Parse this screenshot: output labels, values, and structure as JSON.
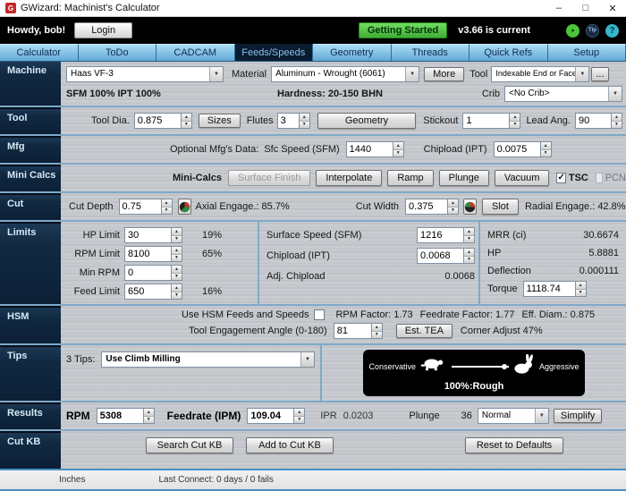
{
  "window": {
    "title": "GWizard: Machinist's Calculator",
    "logo_text": "G",
    "minimize_label": "–",
    "maximize_label": "□",
    "close_label": "✕"
  },
  "topbar": {
    "greeting": "Howdy, bob!",
    "login_label": "Login",
    "getting_started_label": "Getting Started",
    "version_text": "v3.66 is current",
    "tip_label": "Tip",
    "help_label": "?"
  },
  "tabs": [
    {
      "label": "Calculator"
    },
    {
      "label": "ToDo"
    },
    {
      "label": "CADCAM"
    },
    {
      "label": "Feeds/Speeds"
    },
    {
      "label": "Geometry"
    },
    {
      "label": "Threads"
    },
    {
      "label": "Quick Refs"
    },
    {
      "label": "Setup"
    }
  ],
  "sidebar": {
    "items": [
      "Machine",
      "Tool",
      "Mfg",
      "Mini Calcs",
      "Cut",
      "Limits",
      "HSM",
      "Tips",
      "Results",
      "Cut KB"
    ]
  },
  "machine": {
    "machine_select": "Haas VF-3",
    "sfm_ipt": "SFM 100%  IPT 100%",
    "material_label": "Material",
    "material_select": "Aluminum - Wrought (6061)",
    "hardness": "Hardness: 20-150 BHN",
    "more_label": "More",
    "tool_label": "Tool",
    "tool_select": "Indexable End or Face Mill",
    "tool_more_label": "...",
    "crib_label": "Crib",
    "crib_select": "<No Crib>"
  },
  "tool": {
    "dia_label": "Tool Dia.",
    "dia_value": "0.875",
    "sizes_label": "Sizes",
    "flutes_label": "Flutes",
    "flutes_value": "3",
    "geometry_label": "Geometry",
    "stickout_label": "Stickout",
    "stickout_value": "1",
    "lead_label": "Lead Ang.",
    "lead_value": "90"
  },
  "mfg": {
    "optional_label": "Optional Mfg's Data:",
    "sfc_label": "Sfc Speed (SFM)",
    "sfc_value": "1440",
    "chipload_label": "Chipload (IPT)",
    "chipload_value": "0.0075"
  },
  "mini_calcs": {
    "label": "Mini-Calcs",
    "surface_finish_label": "Surface Finish",
    "interpolate_label": "Interpolate",
    "ramp_label": "Ramp",
    "plunge_label": "Plunge",
    "vacuum_label": "Vacuum",
    "tsc_label": "TSC",
    "pcn_label": "PCN"
  },
  "cut": {
    "depth_label": "Cut Depth",
    "depth_value": "0.75",
    "axial_text": "Axial Engage.: 85.7%",
    "width_label": "Cut Width",
    "width_value": "0.375",
    "slot_label": "Slot",
    "radial_text": "Radial Engage.: 42.8%"
  },
  "limits": {
    "rows": [
      {
        "label": "HP Limit",
        "value": "30",
        "pct": "19%"
      },
      {
        "label": "RPM Limit",
        "value": "8100",
        "pct": "65%"
      },
      {
        "label": "Min RPM",
        "value": "0",
        "pct": ""
      },
      {
        "label": "Feed Limit",
        "value": "650",
        "pct": "16%"
      }
    ],
    "surface_speed_label": "Surface Speed (SFM)",
    "surface_speed_value": "1216",
    "chipload_label": "Chipload (IPT)",
    "chipload_value": "0.0068",
    "adj_chipload_label": "Adj. Chipload",
    "adj_chipload_value": "0.0068",
    "mrr_label": "MRR (ci)",
    "mrr_value": "30.6674",
    "hp_label": "HP",
    "hp_value": "5.8881",
    "deflection_label": "Deflection",
    "deflection_value": "0.000111",
    "torque_label": "Torque",
    "torque_value": "1118.74"
  },
  "hsm": {
    "use_label": "Use HSM Feeds and Speeds",
    "rpm_factor": "RPM Factor: 1.73",
    "feedrate_factor": "Feedrate Factor: 1.77",
    "eff_diam": "Eff. Diam.: 0.875",
    "tea_label": "Tool Engagement Angle (0-180)",
    "tea_value": "81",
    "est_tea_label": "Est. TEA",
    "corner_adjust": "Corner Adjust 47%"
  },
  "tips": {
    "count_label": "3 Tips:",
    "selected": "Use Climb Milling",
    "conservative_label": "Conservative",
    "aggressive_label": "Aggressive",
    "slider_caption": "100%:Rough"
  },
  "results": {
    "rpm_label": "RPM",
    "rpm_value": "5308",
    "feedrate_label": "Feedrate (IPM)",
    "feedrate_value": "109.04",
    "ipr_label": "IPR",
    "ipr_value": "0.0203",
    "plunge_label": "Plunge",
    "plunge_value": "36",
    "mode_select": "Normal",
    "simplify_label": "Simplify"
  },
  "cut_kb": {
    "search_label": "Search Cut KB",
    "add_label": "Add to Cut KB",
    "reset_label": "Reset to Defaults"
  },
  "statusbar": {
    "units": "Inches",
    "last_connect": "Last Connect: 0 days / 0 fails"
  }
}
